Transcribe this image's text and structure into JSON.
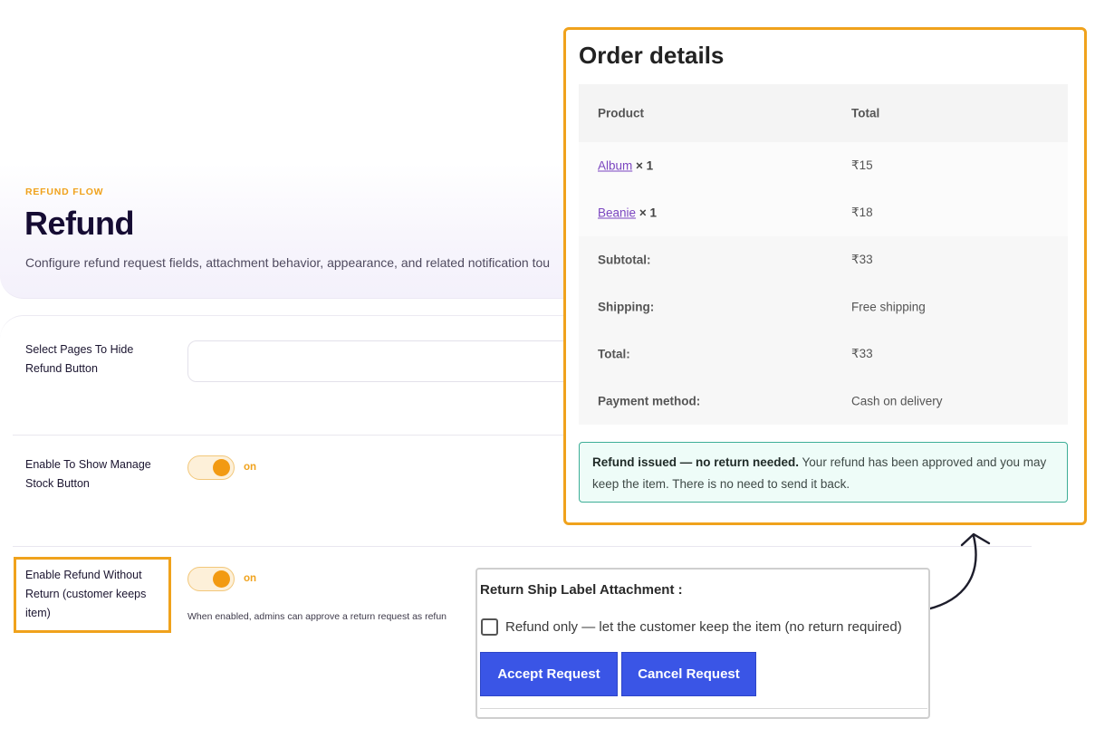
{
  "settings_page": {
    "eyebrow": "REFUND FLOW",
    "title": "Refund",
    "description": "Configure refund request fields, attachment behavior, appearance, and related notification tou",
    "fields": [
      {
        "label_lines": [
          "Select Pages To Hide",
          "Refund Button"
        ]
      },
      {
        "label_lines": [
          "Enable To Show Manage",
          "Stock Button"
        ],
        "toggle_state": "on"
      },
      {
        "label_lines": [
          "Enable Refund Without",
          "Return (customer keeps",
          "item)"
        ],
        "toggle_state": "on",
        "help_text": "When enabled, admins can approve a return request as refun"
      }
    ],
    "accent_color": "#f0a21c"
  },
  "order_details": {
    "title": "Order details",
    "headers": {
      "product": "Product",
      "total": "Total"
    },
    "items": [
      {
        "name": "Album",
        "qty": "× 1",
        "total": "₹15"
      },
      {
        "name": "Beanie",
        "qty": "× 1",
        "total": "₹18"
      }
    ],
    "summary": [
      {
        "label": "Subtotal:",
        "value": "₹33"
      },
      {
        "label": "Shipping:",
        "value": "Free shipping"
      },
      {
        "label": "Total:",
        "value": "₹33"
      },
      {
        "label": "Payment method:",
        "value": "Cash on delivery"
      }
    ],
    "notice": {
      "strong": "Refund issued — no return needed.",
      "text": " Your refund has been approved and you may keep the item. There is no need to send it back."
    }
  },
  "admin_actions": {
    "title": "Return Ship Label Attachment :",
    "checkbox_label": "Refund only — let the customer keep the item (no return required)",
    "checkbox_checked": false,
    "accept_label": "Accept Request",
    "cancel_label": "Cancel Request",
    "button_color": "#3a55e6"
  },
  "icons": {
    "arrow": "curved-arrow-icon"
  }
}
